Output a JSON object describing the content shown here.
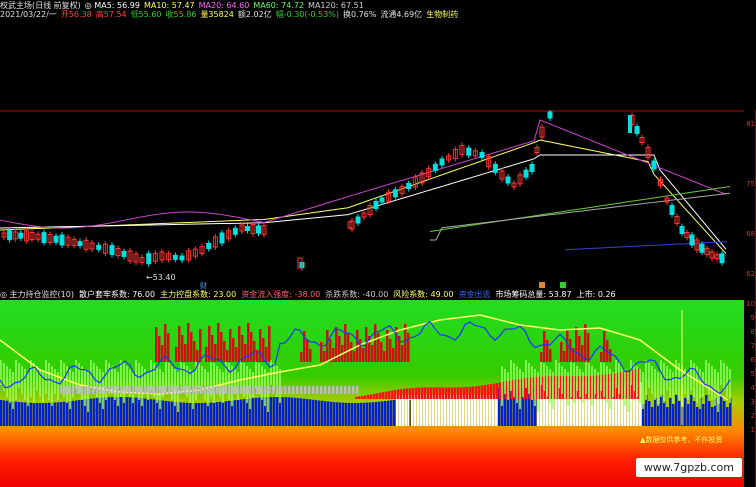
{
  "header": {
    "line1": [
      {
        "text": "权武主场(日线 前复权)",
        "color": "#e0e0e0"
      },
      {
        "text": "◎ MA5: 56.99",
        "color": "#ffffff"
      },
      {
        "text": "MA10: 57.47",
        "color": "#ffff66"
      },
      {
        "text": "MA20: 64.60",
        "color": "#ff66ff"
      },
      {
        "text": "MA60: 74.72",
        "color": "#66ff66"
      },
      {
        "text": "MA120: 67.51",
        "color": "#cccccc"
      }
    ],
    "line2": [
      {
        "text": "2021/03/22/一",
        "color": "#e0e0e0"
      },
      {
        "text": "开56.38",
        "color": "#ff4444"
      },
      {
        "text": "高57.54",
        "color": "#ff4444"
      },
      {
        "text": "低55.60",
        "color": "#33cc33"
      },
      {
        "text": "收55.86",
        "color": "#33cc33"
      },
      {
        "text": "量35824",
        "color": "#ffff66"
      },
      {
        "text": "额2.02亿",
        "color": "#e0e0e0"
      },
      {
        "text": "幅-0.30(-0.53%)",
        "color": "#33cc33"
      },
      {
        "text": "换0.76%",
        "color": "#e0e0e0"
      },
      {
        "text": "流通4.69亿",
        "color": "#e0e0e0"
      },
      {
        "text": "生物制药",
        "color": "#ffff66"
      }
    ]
  },
  "price_chart": {
    "low_label": "←53.40",
    "markers": [
      "财"
    ],
    "axis_labels": [
      "81",
      "75",
      "68",
      "62"
    ]
  },
  "indicator_bar": {
    "items": [
      {
        "text": "◎ 主力持仓监控(10)",
        "color": "#e0e0e0"
      },
      {
        "text": "散户套牢系数: 76.00",
        "color": "#ffffff"
      },
      {
        "text": "主力控盘系数: 23.00",
        "color": "#ffff66"
      },
      {
        "text": "资金流入强度: -38.00",
        "color": "#ff6666"
      },
      {
        "text": "杀跌系数: -40.00",
        "color": "#cccccc"
      },
      {
        "text": "风险系数: 49.00",
        "color": "#ffff66"
      },
      {
        "text": "资金出逃",
        "color": "#3366ff"
      },
      {
        "text": "市场筹码总量: 53.87",
        "color": "#ffffff"
      },
      {
        "text": "上市: 0.26",
        "color": "#ffffff"
      }
    ]
  },
  "ind_axis_labels": [
    "10",
    "9",
    "8",
    "7",
    "6",
    "5",
    "4",
    "3",
    "2",
    "1"
  ],
  "footer_note": "▲数据仅供参考，不作投资",
  "watermark": "www.7gpzb.com",
  "colors": {
    "up": "#ff3333",
    "down": "#00e0e0",
    "green_panel": "#22dd22",
    "blue_bar": "#0022cc",
    "white_bar": "#ffffff"
  }
}
